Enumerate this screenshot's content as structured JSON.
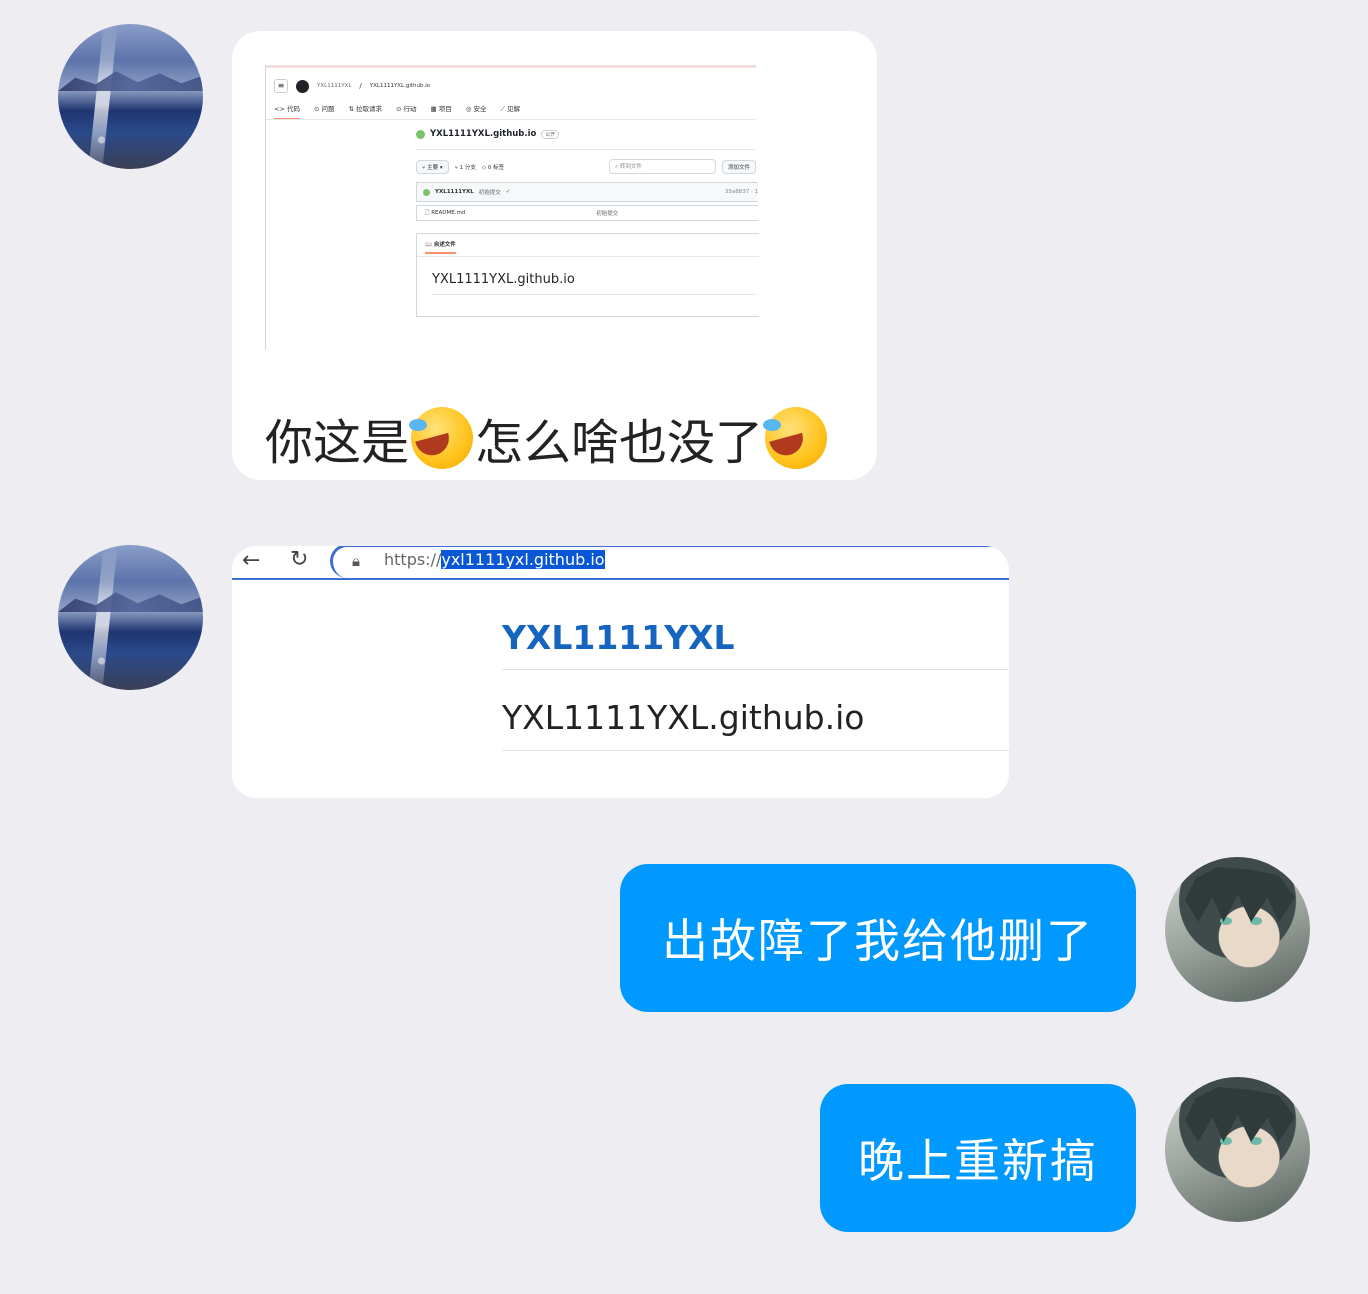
{
  "messages": [
    {
      "side": "left",
      "kind": "image_with_text",
      "avatar": "lake-avatar",
      "screenshot": {
        "owner": "YXL1111YXL",
        "separator": "/",
        "repo": "YXL1111YXL.github.io",
        "tabs": [
          "代码",
          "问题",
          "拉取请求",
          "行动",
          "项目",
          "安全",
          "见解"
        ],
        "repo_title": "YXL1111YXL.github.io",
        "visibility": "公开",
        "branch": "主要",
        "branches": "1 分支",
        "tags": "0 标签",
        "search_placeholder": "转到文件",
        "add_file": "添加文件",
        "commit_user": "YXL1111YXL",
        "commit_msg": "初始提交",
        "commit_hash": "35a8837 · 1",
        "file_name": "README.md",
        "file_commit": "初始提交",
        "readme_tab": "自述文件",
        "readme_title": "YXL1111YXL.github.io"
      },
      "text_parts": [
        "你这是",
        "怎么啥也没了"
      ],
      "emoji": "rofl-crying-emoji"
    },
    {
      "side": "left",
      "kind": "image",
      "avatar": "lake-avatar",
      "browser": {
        "url_prefix": "https://",
        "url_selected": "yxl1111yxl.github.io",
        "page_heading": "YXL1111YXL",
        "page_subtitle": "YXL1111YXL.github.io"
      }
    },
    {
      "side": "right",
      "kind": "text",
      "avatar": "anime-avatar",
      "text": "出故障了我给他删了"
    },
    {
      "side": "right",
      "kind": "text",
      "avatar": "anime-avatar",
      "text": "晚上重新搞"
    }
  ],
  "colors": {
    "background": "#ededf2",
    "self_bubble": "#0099ff",
    "other_bubble": "#ffffff",
    "link_blue": "#1565c0",
    "selection": "#0a57d6"
  }
}
